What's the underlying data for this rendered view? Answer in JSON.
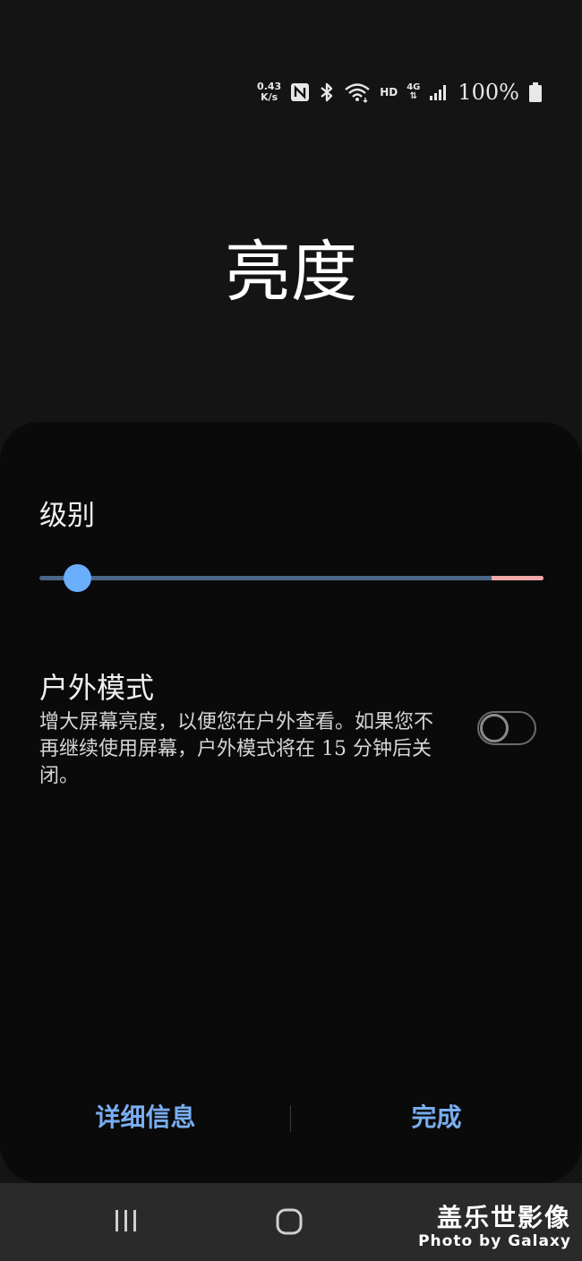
{
  "status_bar": {
    "net_speed_value": "0.43",
    "net_speed_unit": "K/s",
    "nfc_icon": "nfc-icon",
    "bluetooth_icon": "bluetooth-icon",
    "wifi_icon": "wifi-icon",
    "hd_label": "HD",
    "network_label": "4G",
    "signal_icon": "signal-icon",
    "battery_percent": "100%",
    "battery_icon": "battery-icon"
  },
  "title": "亮度",
  "level": {
    "label": "级别",
    "value": 0.05
  },
  "outdoor_mode": {
    "title": "户外模式",
    "description": "增大屏幕亮度，以便您在户外查看。如果您不再继续使用屏幕，户外模式将在 15 分钟后关闭。",
    "enabled": false
  },
  "buttons": {
    "details": "详细信息",
    "done": "完成"
  },
  "nav": {
    "recents_icon": "recents-icon",
    "home_icon": "home-icon"
  },
  "watermark": {
    "main": "盖乐世影像",
    "sub": "Photo by Galaxy"
  },
  "colors": {
    "accent": "#79aef0",
    "slider_thumb": "#6aaefc",
    "slider_track": "#4a6688",
    "slider_end": "#f1a8a8",
    "panel_bg": "#0a0a0a",
    "screen_bg": "#141414"
  }
}
